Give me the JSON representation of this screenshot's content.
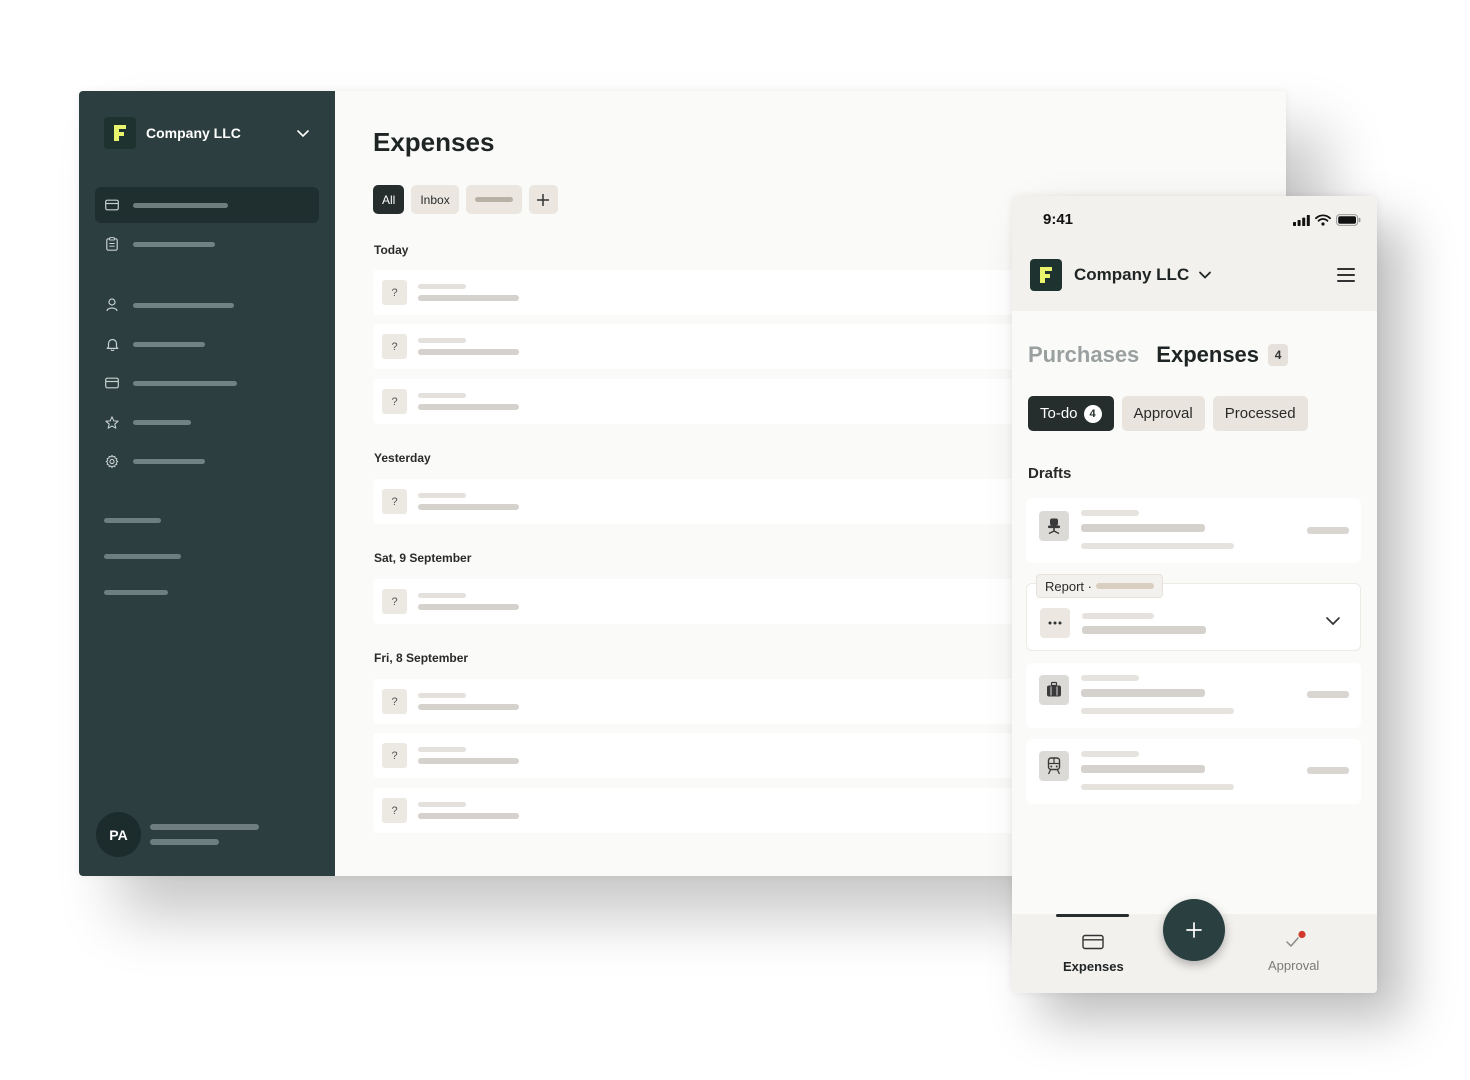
{
  "desktop": {
    "sidebar": {
      "company_name": "Company LLC",
      "logo_letter": "F",
      "nav_items": [
        {
          "icon": "card-icon",
          "active": true
        },
        {
          "icon": "clipboard-icon",
          "active": false
        },
        {
          "icon": "user-icon",
          "active": false
        },
        {
          "icon": "bell-icon",
          "active": false
        },
        {
          "icon": "card-icon",
          "active": false
        },
        {
          "icon": "star-icon",
          "active": false
        },
        {
          "icon": "gear-icon",
          "active": false
        }
      ],
      "user_initials": "PA"
    },
    "main": {
      "title": "Expenses",
      "filters": [
        {
          "label": "All",
          "selected": true
        },
        {
          "label": "Inbox",
          "selected": false
        }
      ],
      "add_symbol": "+",
      "sections": [
        {
          "label": "Today",
          "rows": 3
        },
        {
          "label": "Yesterday",
          "rows": 1
        },
        {
          "label": "Sat, 9 September",
          "rows": 1
        },
        {
          "label": "Fri, 8 September",
          "rows": 3
        }
      ],
      "row_placeholder": "?"
    }
  },
  "mobile": {
    "status_time": "9:41",
    "company_name": "Company LLC",
    "logo_letter": "F",
    "tabs": [
      {
        "label": "Purchases",
        "active": false
      },
      {
        "label": "Expenses",
        "active": true,
        "badge": "4"
      }
    ],
    "filters": [
      {
        "label": "To-do",
        "count": "4",
        "selected": true
      },
      {
        "label": "Approval",
        "selected": false
      },
      {
        "label": "Processed",
        "selected": false
      }
    ],
    "drafts_label": "Drafts",
    "report_tag": "Report ·",
    "cards": [
      {
        "icon": "office-chair-icon"
      },
      {
        "icon": "more-dots-icon",
        "expandable": true
      },
      {
        "icon": "luggage-icon"
      },
      {
        "icon": "train-icon"
      }
    ],
    "bottom_nav": {
      "expenses_label": "Expenses",
      "approval_label": "Approval",
      "fab_symbol": "+"
    },
    "colors": {
      "sidebar": "#2c3e3f",
      "accent_logo": "#e9f36b",
      "notification_dot": "#d0392b"
    }
  }
}
